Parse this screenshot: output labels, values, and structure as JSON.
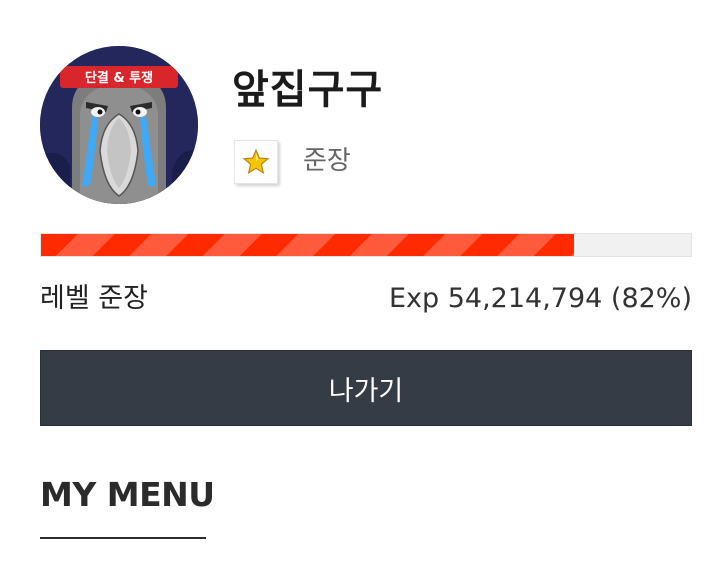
{
  "profile": {
    "nickname": "앞집구구",
    "grade_icon": "star-icon",
    "grade_name": "준장",
    "avatar_banner_text": "단결 & 투쟁"
  },
  "level": {
    "label": "레벨 준장",
    "exp_text": "Exp 54,214,794 (82%)",
    "progress_fraction": 0.82
  },
  "actions": {
    "exit_label": "나가기"
  },
  "menu": {
    "title": "MY MENU"
  },
  "colors": {
    "progress": "#ff2a00",
    "button_bg": "#343c46",
    "star": "#f6c400"
  }
}
